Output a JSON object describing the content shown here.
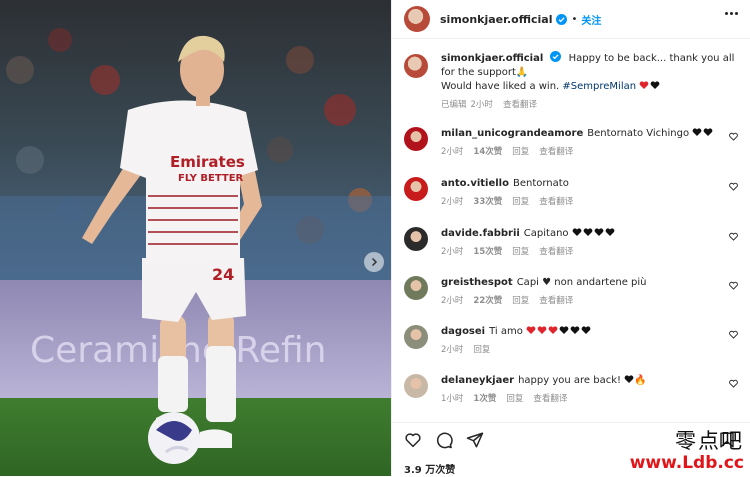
{
  "post": {
    "author": "simonkjaer.official",
    "follow_label": "关注",
    "separator": "•",
    "caption": {
      "user": "simonkjaer.official",
      "text": "Happy to be back... thank you all for the support🙏",
      "text2": "Would have liked a win.",
      "hashtag": "#SempreMilan",
      "meta_edited": "已编辑",
      "meta_time": "2小时",
      "meta_translate": "查看翻译"
    },
    "jersey_sponsor_1": "Emirates",
    "jersey_sponsor_2": "FLY BETTER",
    "jersey_number": "24",
    "board_text": "Ceramiche Refin"
  },
  "comments": [
    {
      "user": "milan_unicograndeamore",
      "text": "Bentornato Vichingo",
      "hearts": [
        "#111",
        "#111"
      ],
      "time": "2小时",
      "likes": "14次赞",
      "reply": "回复",
      "translate": "查看翻译",
      "avatar": "#b2121c"
    },
    {
      "user": "anto.vitiello",
      "text": "Bentornato",
      "hearts": [],
      "time": "2小时",
      "likes": "33次赞",
      "reply": "回复",
      "translate": "查看翻译",
      "avatar": "#c81b1b"
    },
    {
      "user": "davide.fabbrii",
      "text": "Capitano",
      "hearts": [
        "#111",
        "#111",
        "#111",
        "#111"
      ],
      "time": "2小时",
      "likes": "15次赞",
      "reply": "回复",
      "translate": "查看翻译",
      "avatar": "#2b2b2b"
    },
    {
      "user": "greisthespot",
      "text": "Capi ♥ non andartene più",
      "hearts": [],
      "time": "2小时",
      "likes": "22次赞",
      "reply": "回复",
      "translate": "查看翻译",
      "avatar": "#6f7a5c"
    },
    {
      "user": "dagosei",
      "text": "Ti amo",
      "hearts": [
        "#e0242c",
        "#e0242c",
        "#e0242c",
        "#111",
        "#111",
        "#111"
      ],
      "time": "2小时",
      "likes": "",
      "reply": "回复",
      "translate": "",
      "avatar": "#8b8e7a"
    },
    {
      "user": "delaneykjaer",
      "text": "happy you are back!",
      "hearts": [
        "#111"
      ],
      "extra": "🔥",
      "time": "1小时",
      "likes": "1次赞",
      "reply": "回复",
      "translate": "查看翻译",
      "avatar": "#c7b9a6"
    }
  ],
  "actions": {
    "likes": "3.9 万次赞"
  },
  "watermark": {
    "cn": "零点吧",
    "url": "www.Ldb.cc"
  },
  "colors": {
    "link": "#0095f6",
    "muted": "#8e8e8e",
    "heart_red": "#e0242c",
    "hashtag": "#00376b"
  },
  "icons": [
    "verified-badge-icon",
    "more-options-icon",
    "heart-icon",
    "comment-icon",
    "share-icon",
    "bookmark-icon",
    "chevron-right-icon",
    "pray-emoji-icon",
    "fire-emoji-icon"
  ]
}
